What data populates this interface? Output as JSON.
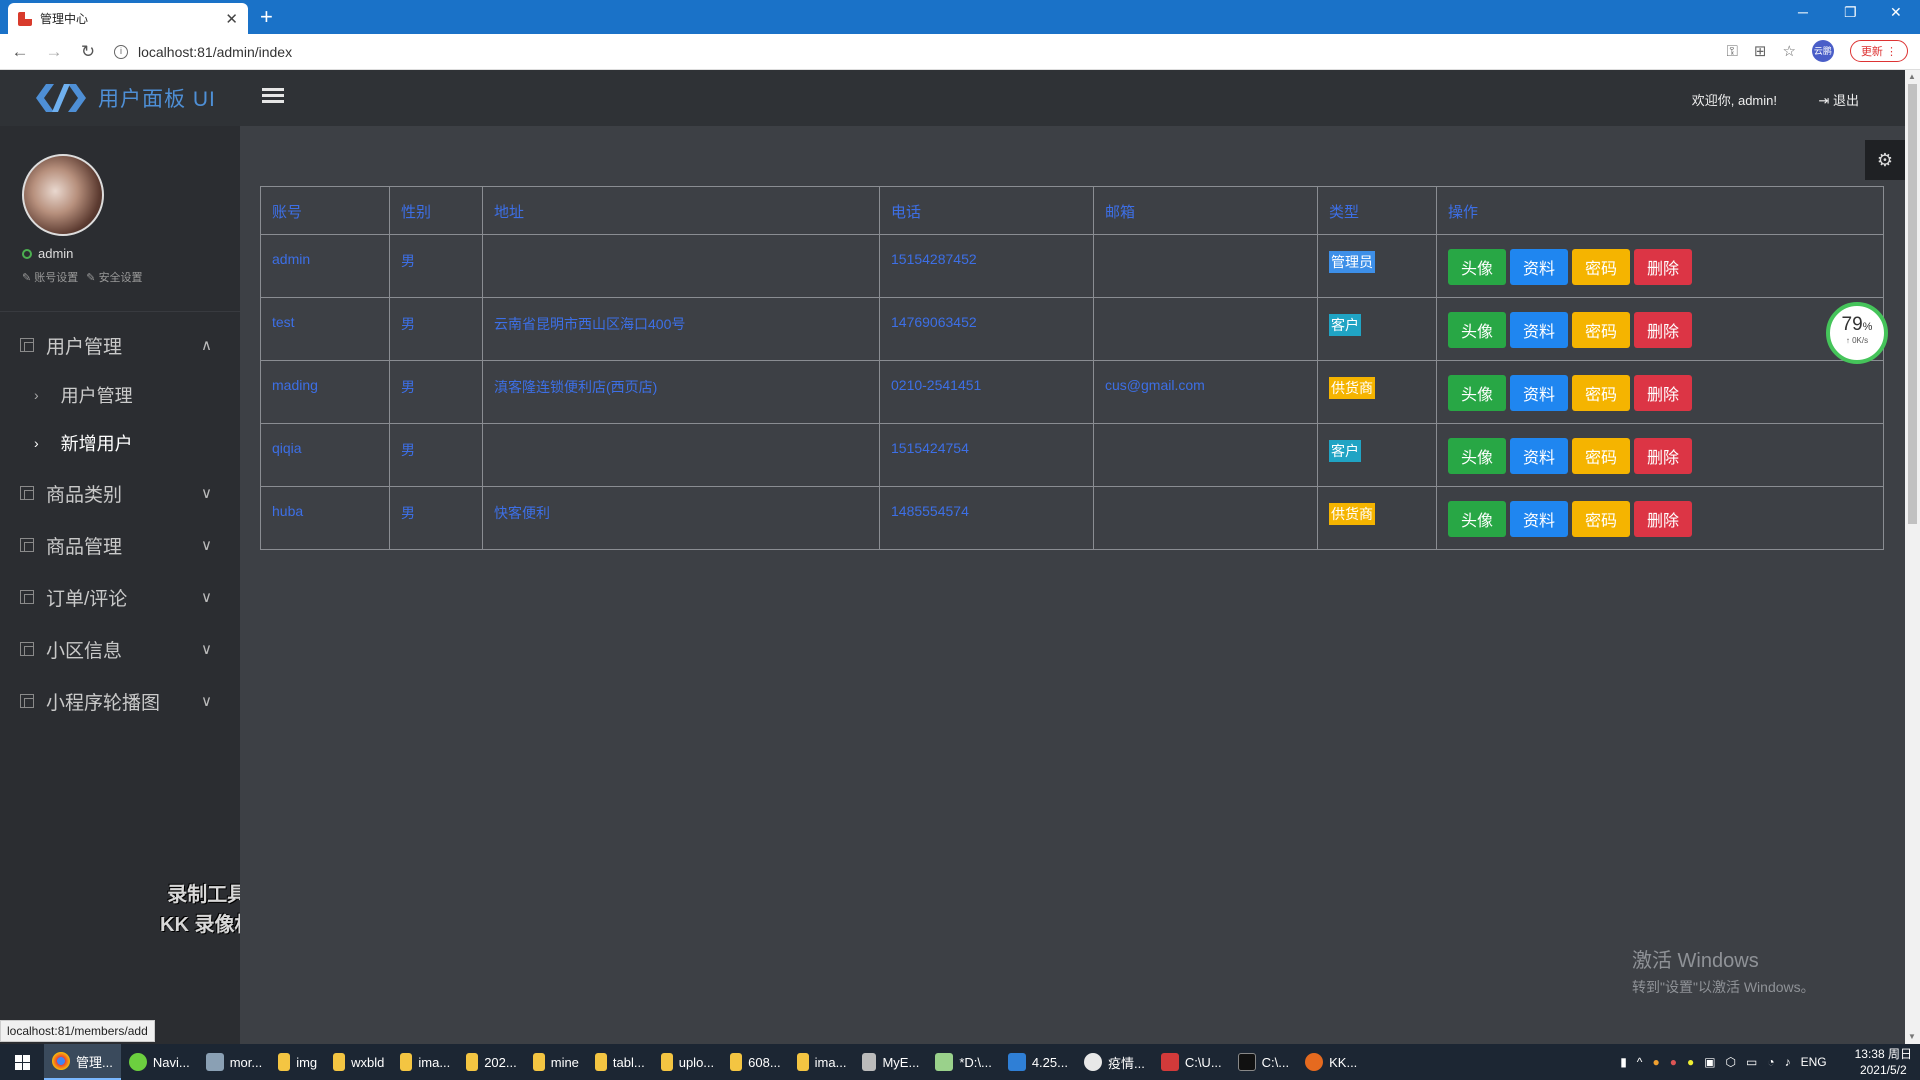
{
  "browser": {
    "tab_title": "管理中心",
    "new_tab": "+",
    "url": "localhost:81/admin/index",
    "update_label": "更新",
    "profile_label": "云鹏",
    "status_url": "localhost:81/members/add"
  },
  "header": {
    "logo_text": "用户面板 UI",
    "welcome": "欢迎你, admin!",
    "logout": "退出"
  },
  "sidebar": {
    "username": "admin",
    "account_settings": "账号设置",
    "security_settings": "安全设置",
    "menu": [
      {
        "label": "用户管理",
        "chevron": "∧"
      },
      {
        "label": "商品类别",
        "chevron": "∨"
      },
      {
        "label": "商品管理",
        "chevron": "∨"
      },
      {
        "label": "订单/评论",
        "chevron": "∨"
      },
      {
        "label": "小区信息",
        "chevron": "∨"
      },
      {
        "label": "小程序轮播图",
        "chevron": "∨"
      }
    ],
    "submenu": [
      {
        "label": "用户管理"
      },
      {
        "label": "新增用户"
      }
    ],
    "watermark_line1": "录制工具",
    "watermark_line2": "KK 录像机"
  },
  "table": {
    "headers": [
      "账号",
      "性别",
      "地址",
      "电话",
      "邮箱",
      "类型",
      "操作"
    ],
    "rows": [
      {
        "account": "admin",
        "gender": "男",
        "address": "",
        "phone": "15154287452",
        "email": "",
        "type": "管理员"
      },
      {
        "account": "test",
        "gender": "男",
        "address": "云南省昆明市西山区海口400号",
        "phone": "14769063452",
        "email": "",
        "type": "客户"
      },
      {
        "account": "mading",
        "gender": "男",
        "address": "滇客隆连锁便利店(西页店)",
        "phone": "0210-2541451",
        "email": "cus@gmail.com",
        "type": "供货商"
      },
      {
        "account": "qiqia",
        "gender": "男",
        "address": "",
        "phone": "1515424754",
        "email": "",
        "type": "客户"
      },
      {
        "account": "huba",
        "gender": "男",
        "address": "快客便利",
        "phone": "1485554574",
        "email": "",
        "type": "供货商"
      }
    ],
    "actions": {
      "avatar": "头像",
      "profile": "资料",
      "password": "密码",
      "delete": "删除"
    }
  },
  "speed_widget": {
    "percent": "79",
    "pct_sign": "%",
    "rate": "↑ 0K/s"
  },
  "windows_activation": {
    "line1": "激活 Windows",
    "line2": "转到\"设置\"以激活 Windows。"
  },
  "taskbar": {
    "items": [
      "管理...",
      "Navi...",
      "mor...",
      "img",
      "wxbld",
      "ima...",
      "202...",
      "mine",
      "tabl...",
      "uplo...",
      "608...",
      "ima...",
      "MyE...",
      "*D:\\...",
      "4.25...",
      "疫情...",
      "C:\\U...",
      "C:\\...",
      "KK..."
    ],
    "lang": "ENG",
    "time": "13:38 周日",
    "date": "2021/5/2"
  },
  "colors": {
    "link_blue": "#3d6fe6",
    "btn_green": "#28a745",
    "btn_blue": "#1f86f0",
    "btn_yellow": "#f5b400",
    "btn_red": "#dc3545",
    "header_bg": "#2f3236",
    "sidebar_bg": "#2b2d31",
    "content_bg": "#3d4045"
  }
}
